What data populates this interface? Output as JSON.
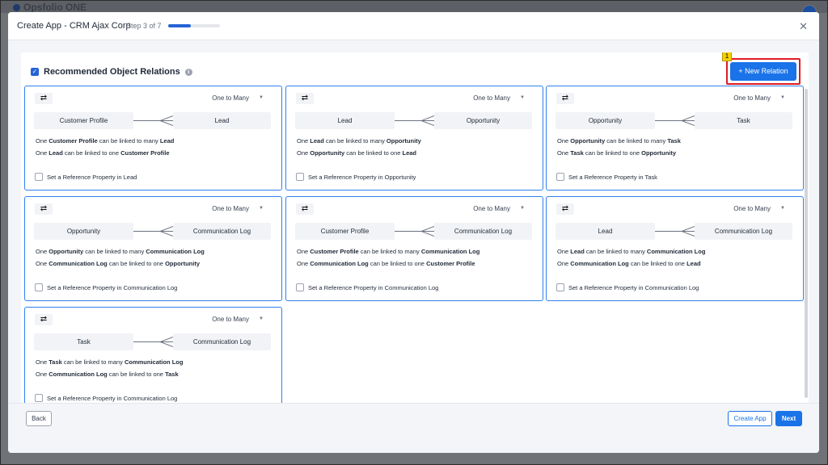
{
  "background": {
    "brand": "Opsfolio ONE"
  },
  "header": {
    "title": "Create App  - CRM Ajax Corp",
    "step": "Step 3 of 7",
    "progress": 0.43
  },
  "section": {
    "title": "Recommended Object Relations",
    "new_relation_label": "+ New Relation",
    "badge": "1"
  },
  "relations": [
    {
      "type": "One to Many",
      "left": "Customer Profile",
      "right": "Lead",
      "l1": [
        "One ",
        "Customer Profile",
        " can be linked to many ",
        "Lead"
      ],
      "l2": [
        "One ",
        "Lead",
        " can be linked to one ",
        "Customer Profile"
      ],
      "ref": "Set a Reference Property in Lead"
    },
    {
      "type": "One to Many",
      "left": "Lead",
      "right": "Opportunity",
      "l1": [
        "One ",
        "Lead",
        " can be linked to many ",
        "Opportunity"
      ],
      "l2": [
        "One ",
        "Opportunity",
        " can be linked to one ",
        "Lead"
      ],
      "ref": "Set a Reference Property in Opportunity"
    },
    {
      "type": "One to Many",
      "left": "Opportunity",
      "right": "Task",
      "l1": [
        "One ",
        "Opportunity",
        " can be linked to many ",
        "Task"
      ],
      "l2": [
        "One ",
        "Task",
        " can be linked to one ",
        "Opportunity"
      ],
      "ref": "Set a Reference Property in Task"
    },
    {
      "type": "One to Many",
      "left": "Opportunity",
      "right": "Communication Log",
      "l1": [
        "One ",
        "Opportunity",
        " can be linked to many ",
        "Communication Log"
      ],
      "l2": [
        "One ",
        "Communication Log",
        " can be linked to one ",
        "Opportunity"
      ],
      "ref": "Set a Reference Property in Communication Log"
    },
    {
      "type": "One to Many",
      "left": "Customer Profile",
      "right": "Communication Log",
      "l1": [
        "One ",
        "Customer Profile",
        " can be linked to many ",
        "Communication Log"
      ],
      "l2": [
        "One ",
        "Communication Log",
        " can be linked to one ",
        "Customer Profile"
      ],
      "ref": "Set a Reference Property in Communication Log"
    },
    {
      "type": "One to Many",
      "left": "Lead",
      "right": "Communication Log",
      "l1": [
        "One ",
        "Lead",
        " can be linked to many ",
        "Communication Log"
      ],
      "l2": [
        "One ",
        "Communication Log",
        " can be linked to one ",
        "Lead"
      ],
      "ref": "Set a Reference Property in Communication Log"
    },
    {
      "type": "One to Many",
      "left": "Task",
      "right": "Communication Log",
      "l1": [
        "One ",
        "Task",
        " can be linked to many ",
        "Communication Log"
      ],
      "l2": [
        "One ",
        "Communication Log",
        " can be linked to one ",
        "Task"
      ],
      "ref": "Set a Reference Property in Communication Log"
    }
  ],
  "footer": {
    "back": "Back",
    "create_app": "Create App",
    "next": "Next"
  },
  "colors": {
    "accent": "#1a73e8",
    "card_border": "#2f80ed",
    "highlight": "#e01b24"
  },
  "icons": [
    "close-icon",
    "info-icon",
    "swap-icon",
    "chevron-down-icon",
    "checkbox-checked-icon"
  ]
}
